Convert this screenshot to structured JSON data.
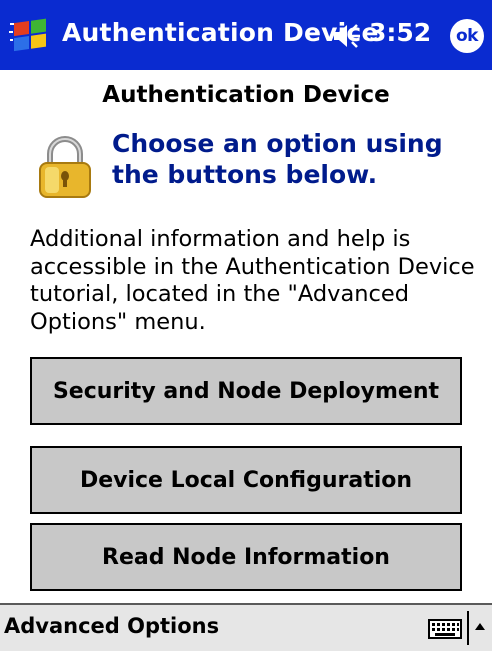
{
  "titlebar": {
    "title": "Authentication Device",
    "time": "3:52",
    "ok_label": "ok",
    "color": "#0a2bd0"
  },
  "main": {
    "heading": "Authentication Device",
    "instruction": "Choose an option using the buttons below.",
    "info": "Additional information and help is accessible in the Authentication Device tutorial, located in the \"Advanced Options\" menu.",
    "buttons": [
      {
        "label": "Security and Node Deployment"
      },
      {
        "label": "Device Local Configuration"
      },
      {
        "label": "Read Node Information"
      }
    ]
  },
  "menubar": {
    "advanced_options": "Advanced Options"
  },
  "icons": {
    "start": "windows-flag-icon",
    "volume": "speaker-icon",
    "lock": "padlock-icon",
    "keyboard": "keyboard-icon",
    "sip": "up-arrow-icon"
  }
}
